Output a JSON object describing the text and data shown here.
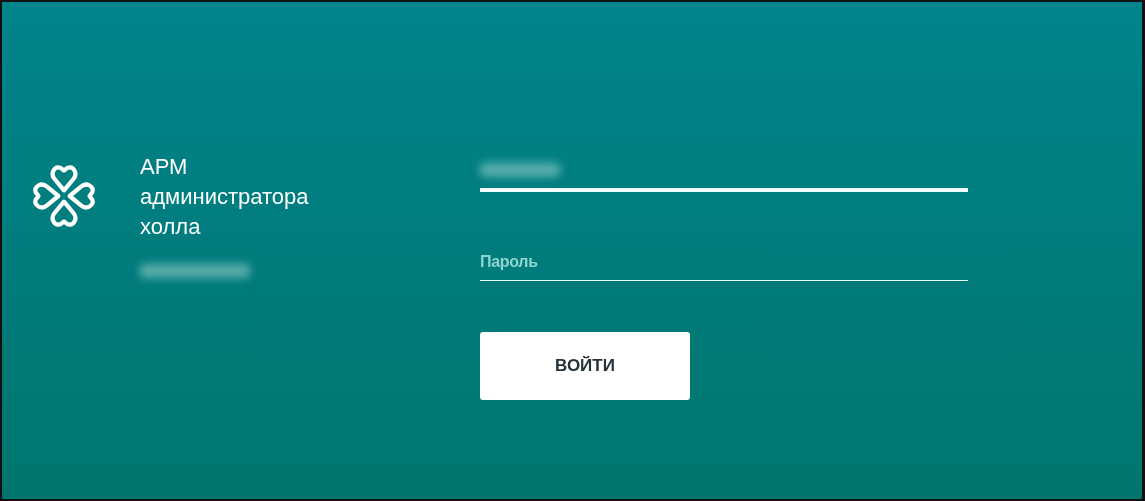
{
  "app": {
    "title_lines": [
      "АРМ",
      "администратора",
      "холла"
    ]
  },
  "login_form": {
    "fields": [
      {
        "kind": "login",
        "redacted_value": true,
        "focused": true
      },
      {
        "kind": "password",
        "placeholder": "Пароль",
        "focused": false
      }
    ],
    "submit_button": {
      "label": "ВОЙТИ"
    }
  }
}
